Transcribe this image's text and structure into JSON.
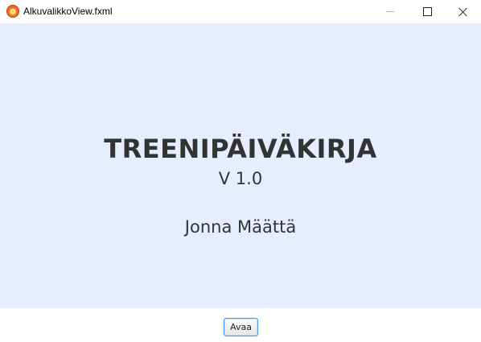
{
  "window": {
    "title": "AlkuvalikkoView.fxml",
    "app_icon": "javafx-app-icon",
    "controls": {
      "minimize": "minimize-icon",
      "maximize": "maximize-icon",
      "close": "close-icon"
    }
  },
  "main": {
    "title": "TREENIPÄIVÄKIRJA",
    "version": "V 1.0",
    "author": "Jonna Määttä"
  },
  "footer": {
    "open_label": "Avaa"
  },
  "colors": {
    "content_background": "#e6edfe",
    "text": "#333333",
    "button_focus": "#3b99fc"
  }
}
